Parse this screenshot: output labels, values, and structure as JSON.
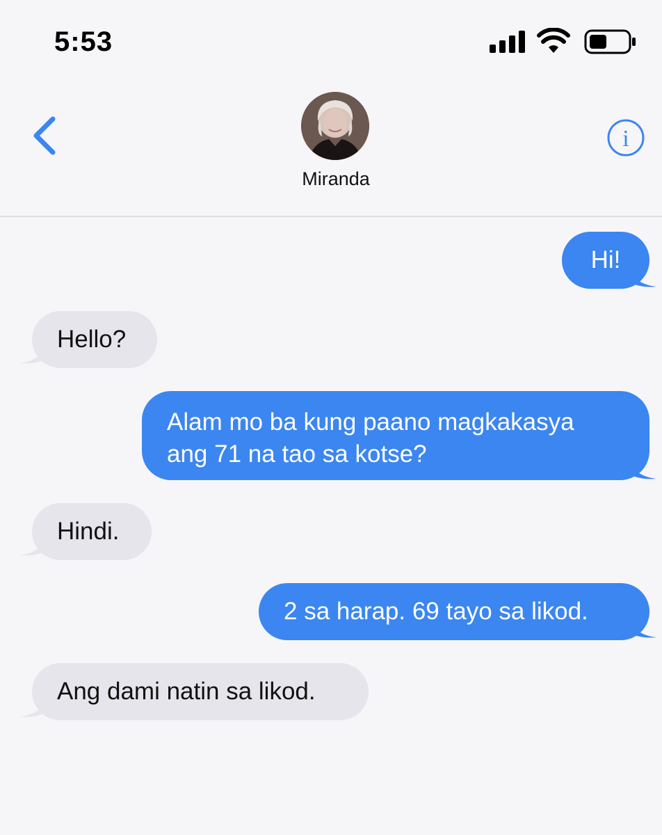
{
  "status_bar": {
    "time": "5:53"
  },
  "header": {
    "contact_name": "Miranda",
    "avatar_description_icon": "contact-avatar",
    "back_icon": "chevron-left-icon",
    "info_icon": "info-icon",
    "accent_color": "#3b86f0"
  },
  "messages": [
    {
      "direction": "sent",
      "lines": [
        "Hi!"
      ]
    },
    {
      "direction": "received",
      "lines": [
        "Hello?"
      ]
    },
    {
      "direction": "sent",
      "lines": [
        "Alam mo ba kung paano magkakasya",
        "ang 71 na tao sa kotse?"
      ]
    },
    {
      "direction": "received",
      "lines": [
        "Hindi."
      ]
    },
    {
      "direction": "sent",
      "lines": [
        "2 sa harap. 69 tayo sa likod."
      ]
    },
    {
      "direction": "received",
      "lines": [
        "Ang dami natin sa likod."
      ]
    }
  ],
  "colors": {
    "sent_bubble": "#3b86f0",
    "received_bubble": "#e6e5eb",
    "background": "#f6f6f8"
  }
}
